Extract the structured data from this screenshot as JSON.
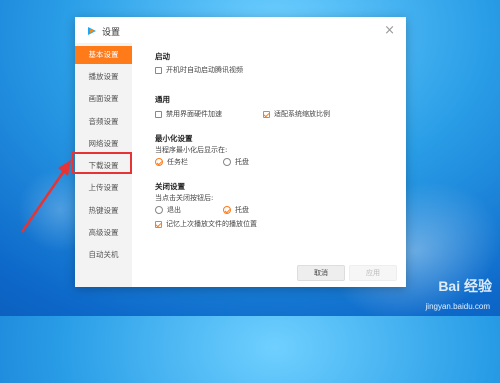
{
  "window": {
    "title": "设置",
    "close_glyph": "×"
  },
  "sidebar": {
    "items": [
      {
        "label": "基本设置",
        "active": true
      },
      {
        "label": "播放设置",
        "active": false
      },
      {
        "label": "画面设置",
        "active": false
      },
      {
        "label": "音频设置",
        "active": false
      },
      {
        "label": "网络设置",
        "active": false
      },
      {
        "label": "下载设置",
        "active": false
      },
      {
        "label": "上传设置",
        "active": false
      },
      {
        "label": "热键设置",
        "active": false
      },
      {
        "label": "高级设置",
        "active": false
      },
      {
        "label": "自动关机",
        "active": false
      }
    ]
  },
  "sections": {
    "startup": {
      "title": "启动",
      "autostart_label": "开机时自动启动腾讯视频",
      "autostart_checked": false
    },
    "general": {
      "title": "通用",
      "hwaccel_label": "禁用界面硬件加速",
      "hwaccel_checked": false,
      "scale_label": "适配系统缩放比例",
      "scale_checked": true
    },
    "minimize": {
      "title": "最小化设置",
      "prompt": "当程序最小化后显示在:",
      "taskbar_label": "任务栏",
      "taskbar_selected": true,
      "tray_label": "托盘",
      "tray_selected": false
    },
    "close": {
      "title": "关闭设置",
      "prompt": "当点击关闭按钮后:",
      "exit_label": "退出",
      "exit_selected": false,
      "tray_label": "托盘",
      "tray_selected": true,
      "remember_label": "记忆上次播放文件的播放位置",
      "remember_checked": true
    }
  },
  "buttons": {
    "cancel": "取消",
    "apply": "应用"
  },
  "watermark": {
    "brand": "Bai 经验",
    "url": "jingyan.baidu.com"
  },
  "colors": {
    "accent": "#ff7a19",
    "annotation": "#e63333"
  }
}
